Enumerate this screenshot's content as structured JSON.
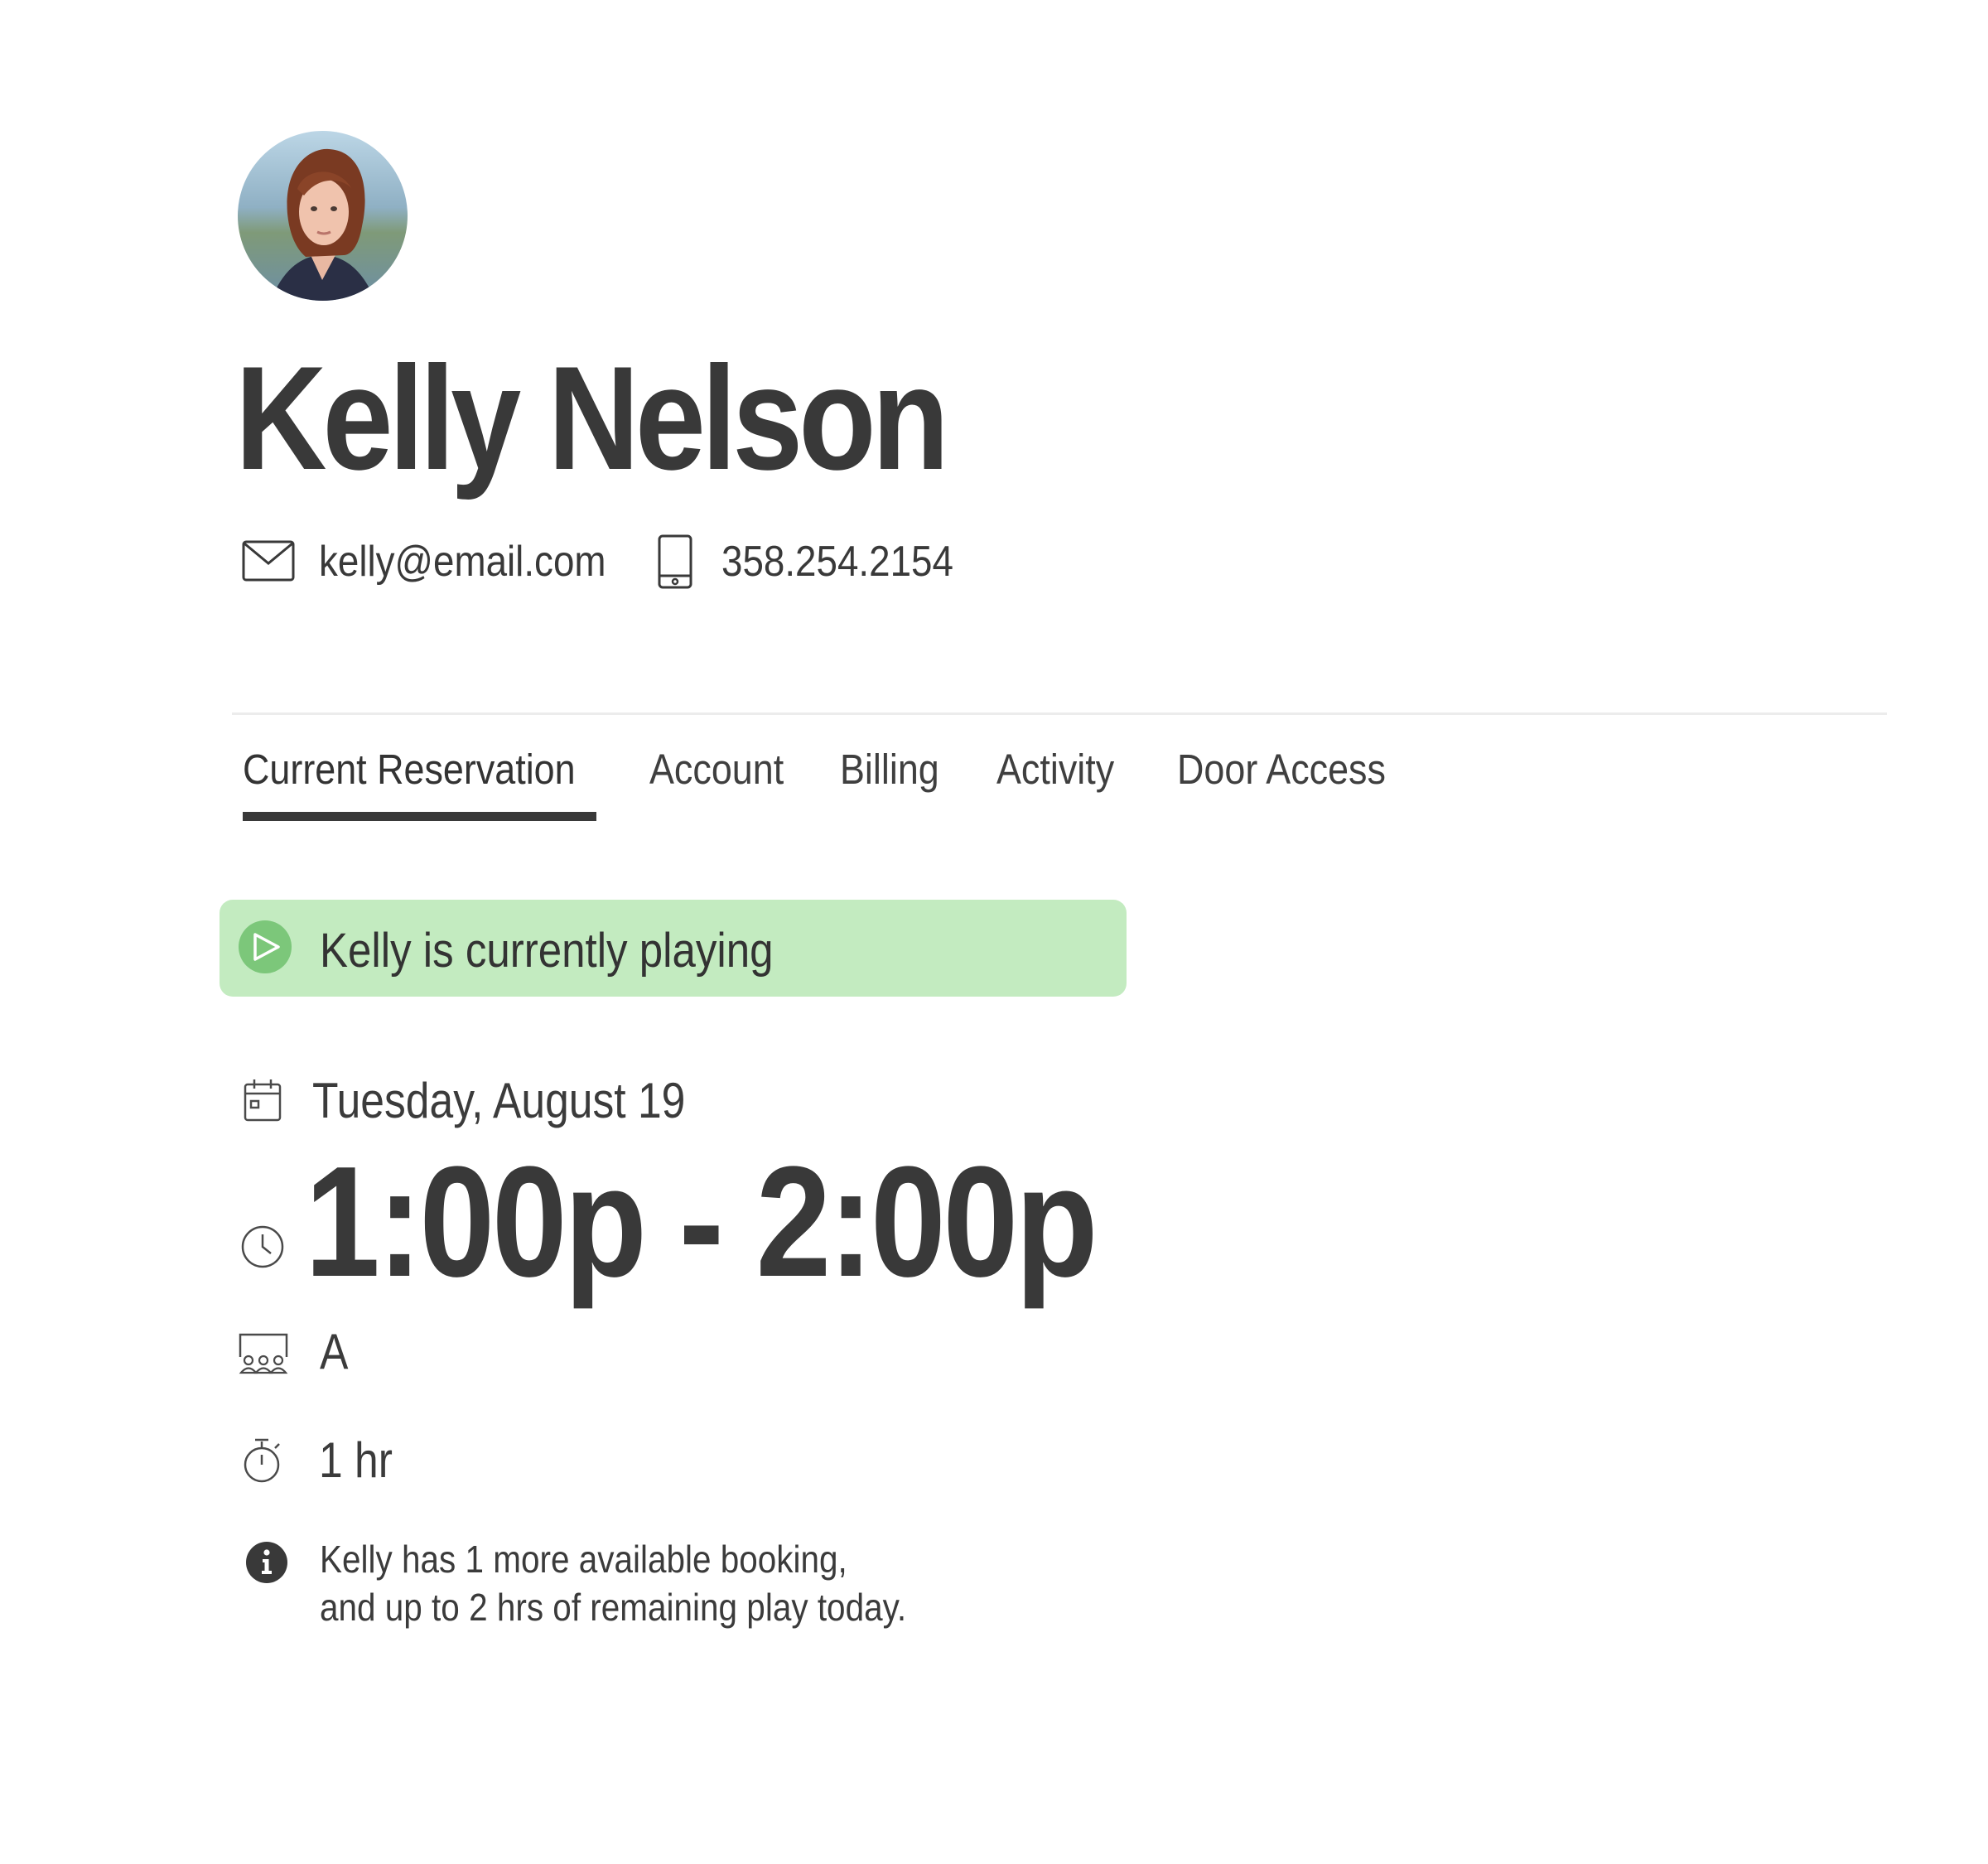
{
  "profile": {
    "name": "Kelly Nelson",
    "email": "kelly@email.com",
    "phone": "358.254.2154"
  },
  "tabs": [
    {
      "label": "Current Reservation",
      "active": true
    },
    {
      "label": "Account",
      "active": false
    },
    {
      "label": "Billing",
      "active": false
    },
    {
      "label": "Activity",
      "active": false
    },
    {
      "label": "Door Access",
      "active": false
    }
  ],
  "status": {
    "text": "Kelly is currently playing",
    "color": "#c3ebc0",
    "icon": "play-icon"
  },
  "reservation": {
    "date": "Tuesday, August 19",
    "time": "1:00p - 2:00p",
    "court": "A",
    "duration": "1 hr",
    "info_line1": "Kelly has 1 more available booking,",
    "info_line2": "and up to 2 hrs of remaining play today."
  },
  "colors": {
    "text": "#393939",
    "status_bg": "#c3ebc0",
    "status_icon": "#7cc77a"
  }
}
